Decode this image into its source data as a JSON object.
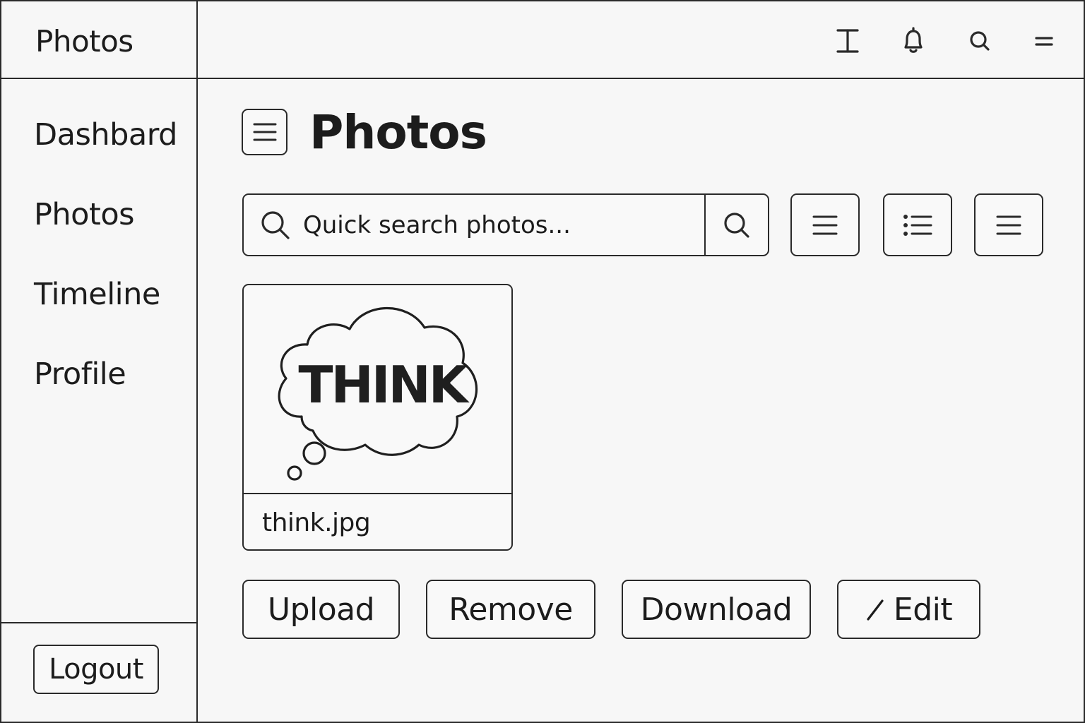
{
  "sidebar": {
    "brand": "Photos",
    "items": [
      {
        "label": "Dashbard"
      },
      {
        "label": "Photos"
      },
      {
        "label": "Timeline"
      },
      {
        "label": "Profile"
      }
    ],
    "logout_label": "Logout"
  },
  "topbar": {
    "icons": [
      "text-cursor-icon",
      "bell-icon",
      "search-icon",
      "menu-icon"
    ]
  },
  "main": {
    "title": "Photos",
    "search": {
      "placeholder": "Quick search photos..."
    },
    "view_buttons": [
      "lines-icon",
      "bulleted-list-icon",
      "lines-icon"
    ],
    "photos": [
      {
        "filename": "think.jpg",
        "image_text": "THINK"
      }
    ],
    "actions": {
      "upload": "Upload",
      "remove": "Remove",
      "download": "Download",
      "edit": "Edit"
    }
  },
  "colors": {
    "background": "#f7f7f7",
    "stroke": "#2a2a2a",
    "text": "#1c1c1c"
  }
}
